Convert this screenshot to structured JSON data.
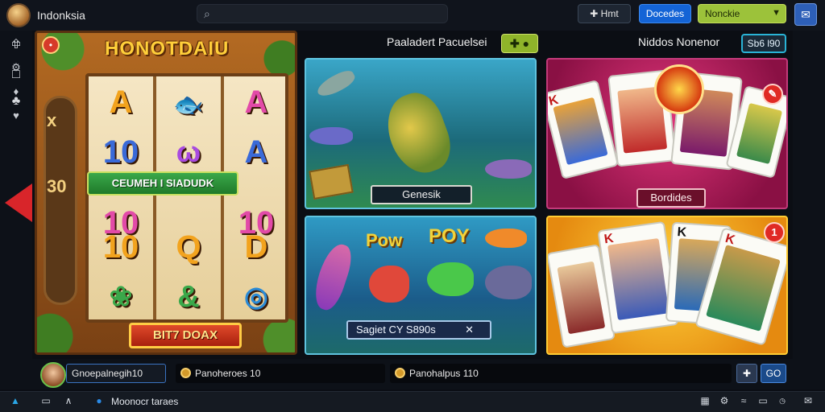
{
  "topbar": {
    "title": "Indonksia",
    "btn1": "✚ Hmt",
    "btn2": "Docedes",
    "dropdown": "Nonckie",
    "icons": [
      "search-icon",
      "chat-icon"
    ]
  },
  "slot": {
    "title": "HONOTDAIU",
    "banner": "CEUMEH I SIADUDK",
    "spin": "BIT7 DOAX",
    "side_top": "x",
    "side_mid": "30",
    "symbols": [
      "A",
      "A",
      "10",
      "A",
      "10",
      "10",
      "Q",
      "D"
    ]
  },
  "center": {
    "header": "Paaladert Pacuelsei",
    "plus": "✚ ●",
    "card1_button": "Genesik",
    "card2_button": "Sagiet CY S890s",
    "card2_arrow": "✕",
    "card2_texts": [
      "Pow",
      "POY"
    ]
  },
  "right": {
    "header": "Niddos Nonenor",
    "score": "Sb6 l90",
    "card1_button": "Bordides",
    "card2_badge": "1",
    "card1_badge": "✎"
  },
  "statusbar": {
    "user": "Gnoepalnegih10",
    "stat1": "Panoheroes 10",
    "stat2": "Panohalpus 110",
    "btn_left": "✚",
    "btn_right": "GO"
  },
  "taskbar": {
    "app_label": "Moonocr taraes",
    "icons": [
      "start-icon",
      "chat-icon",
      "share-icon",
      "wifi-icon",
      "battery-icon",
      "clock-icon"
    ]
  },
  "colors": {
    "accent_blue": "#1464d6",
    "accent_green": "#9cc23a",
    "score_cyan": "#29b3d6",
    "card_magenta": "#c23a7a",
    "card_gold": "#ffcc33"
  }
}
